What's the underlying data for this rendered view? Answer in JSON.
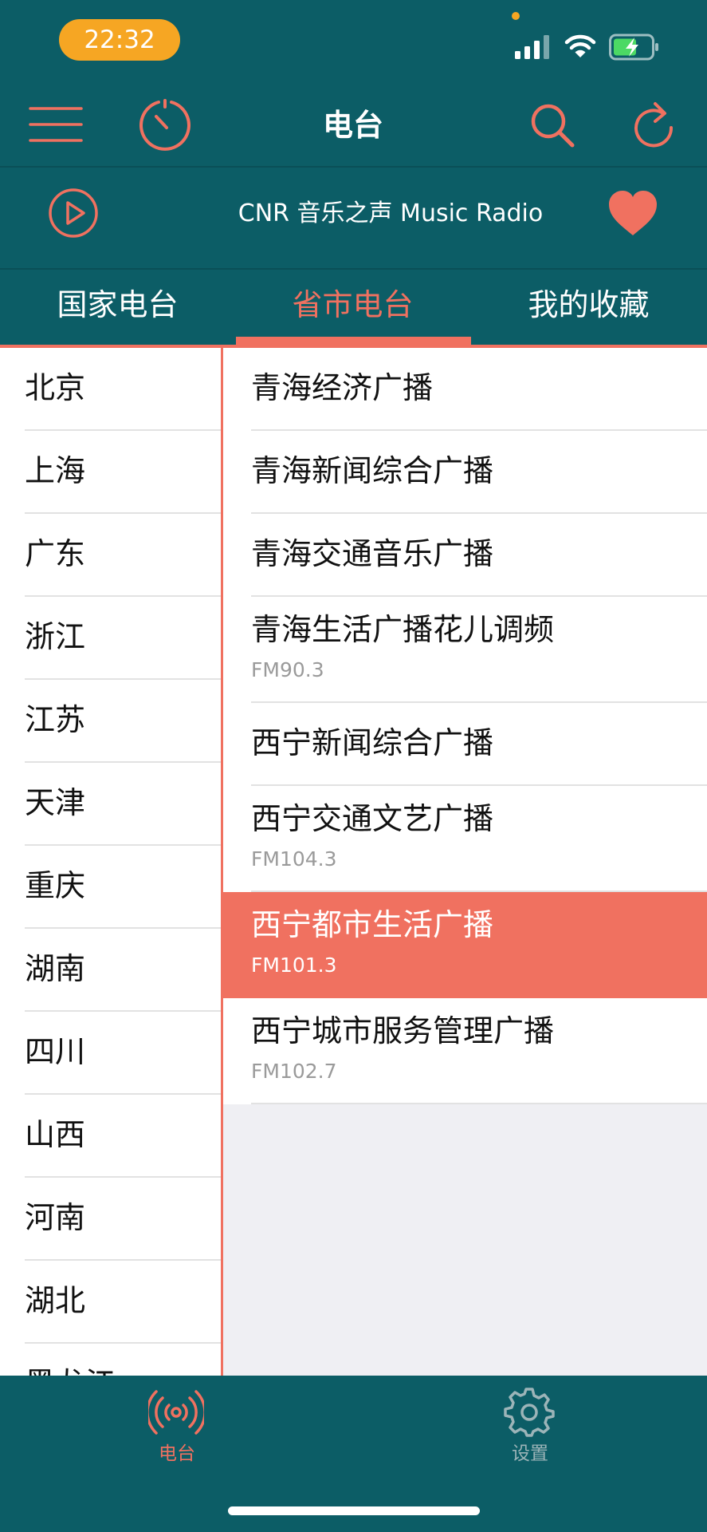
{
  "status_bar": {
    "time": "22:32",
    "signal_icon": "cellular-signal-icon",
    "wifi_icon": "wifi-icon",
    "battery_icon": "battery-charging-icon"
  },
  "nav": {
    "title": "电台",
    "menu_icon": "hamburger-menu-icon",
    "timer_icon": "sleep-timer-icon",
    "search_icon": "search-icon",
    "refresh_icon": "refresh-icon"
  },
  "now_playing": {
    "play_icon": "play-icon",
    "station": "CNR 音乐之声  Music Radio",
    "favorite_icon": "heart-icon"
  },
  "tabs": [
    {
      "label": "国家电台",
      "active": false
    },
    {
      "label": "省市电台",
      "active": true
    },
    {
      "label": "我的收藏",
      "active": false
    }
  ],
  "provinces": [
    "北京",
    "上海",
    "广东",
    "浙江",
    "江苏",
    "天津",
    "重庆",
    "湖南",
    "四川",
    "山西",
    "河南",
    "湖北",
    "黑龙江"
  ],
  "stations": [
    {
      "name": "青海经济广播",
      "freq": "",
      "selected": false
    },
    {
      "name": "青海新闻综合广播",
      "freq": "",
      "selected": false
    },
    {
      "name": "青海交通音乐广播",
      "freq": "",
      "selected": false
    },
    {
      "name": "青海生活广播花儿调频",
      "freq": "FM90.3",
      "selected": false
    },
    {
      "name": "西宁新闻综合广播",
      "freq": "",
      "selected": false
    },
    {
      "name": "西宁交通文艺广播",
      "freq": "FM104.3",
      "selected": false
    },
    {
      "name": "西宁都市生活广播",
      "freq": "FM101.3",
      "selected": true
    },
    {
      "name": "西宁城市服务管理广播",
      "freq": "FM102.7",
      "selected": false
    }
  ],
  "bottom_tabs": {
    "radio": {
      "label": "电台",
      "icon": "radio-broadcast-icon",
      "active": true
    },
    "settings": {
      "label": "设置",
      "icon": "gear-icon",
      "active": false
    }
  },
  "colors": {
    "primary_teal": "#0c5d66",
    "accent_coral": "#f07160",
    "status_time_bg": "#f6a623"
  }
}
